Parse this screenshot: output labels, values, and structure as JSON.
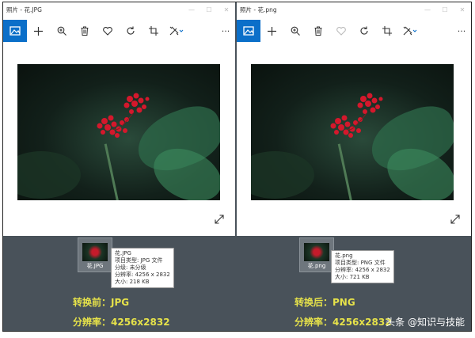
{
  "colors": {
    "accent": "#0b6fc9",
    "caption": "#e6e24a",
    "panel": "#49525a"
  },
  "left_window": {
    "title": "照片 - 花.JPG",
    "toolbar": [
      "image-view-icon",
      "plus-icon",
      "zoom-in-icon",
      "delete-icon",
      "heart-icon",
      "rotate-icon",
      "crop-icon",
      "edit-icon",
      "more-icon"
    ],
    "more_label": "···"
  },
  "right_window": {
    "title": "照片 - 花.png",
    "more_label": "···"
  },
  "window_controls": {
    "minimize": "—",
    "maximize": "☐",
    "close": "✕"
  },
  "left_file": {
    "icon_name": "花.JPG",
    "tooltip": [
      "花.JPG",
      "项目类型: JPG 文件",
      "分级: 未分级",
      "分辨率: 4256 x 2832",
      "大小: 218 KB"
    ]
  },
  "right_file": {
    "icon_name": "花.png",
    "tooltip": [
      "花.png",
      "项目类型: PNG 文件",
      "分辨率: 4256 x 2832",
      "大小: 721 KB"
    ]
  },
  "captions": {
    "left_format": "转换前：JPG",
    "left_resolution": "分辨率：4256x2832",
    "right_format": "转换后：PNG",
    "right_resolution": "分辨率：4256x2832"
  },
  "watermark": "头条 @知识与技能"
}
